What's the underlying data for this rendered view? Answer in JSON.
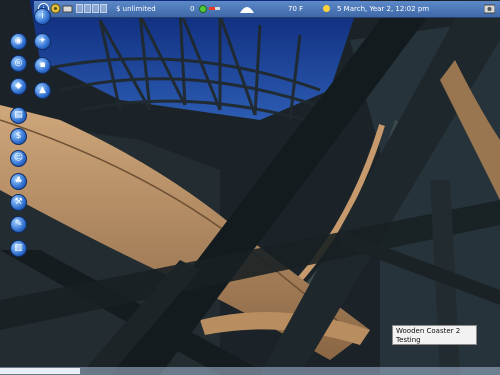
{
  "statusbar": {
    "money": "$ unlimited",
    "guests": "0",
    "temperature": "70 F",
    "date_time": "5 March, Year 2, 12:02 pm"
  },
  "tooltip": {
    "ride_name": "Wooden Coaster 2",
    "status": "Testing"
  },
  "toolbar_icons": [
    "info-icon",
    "map-icon",
    "view-icon",
    "eye-icon",
    "disk-icon",
    "terrain-icon",
    "path-icon",
    "clipboard-icon",
    "lamp-icon",
    "rides-icon",
    "park-icon",
    "hammer-icon",
    "wrench-icon",
    "trash-icon"
  ],
  "colors": {
    "bar": "#4a76b8",
    "sky": "#1c3f8a",
    "wood": "#b68a5a",
    "steel": "#2f3b3f"
  }
}
